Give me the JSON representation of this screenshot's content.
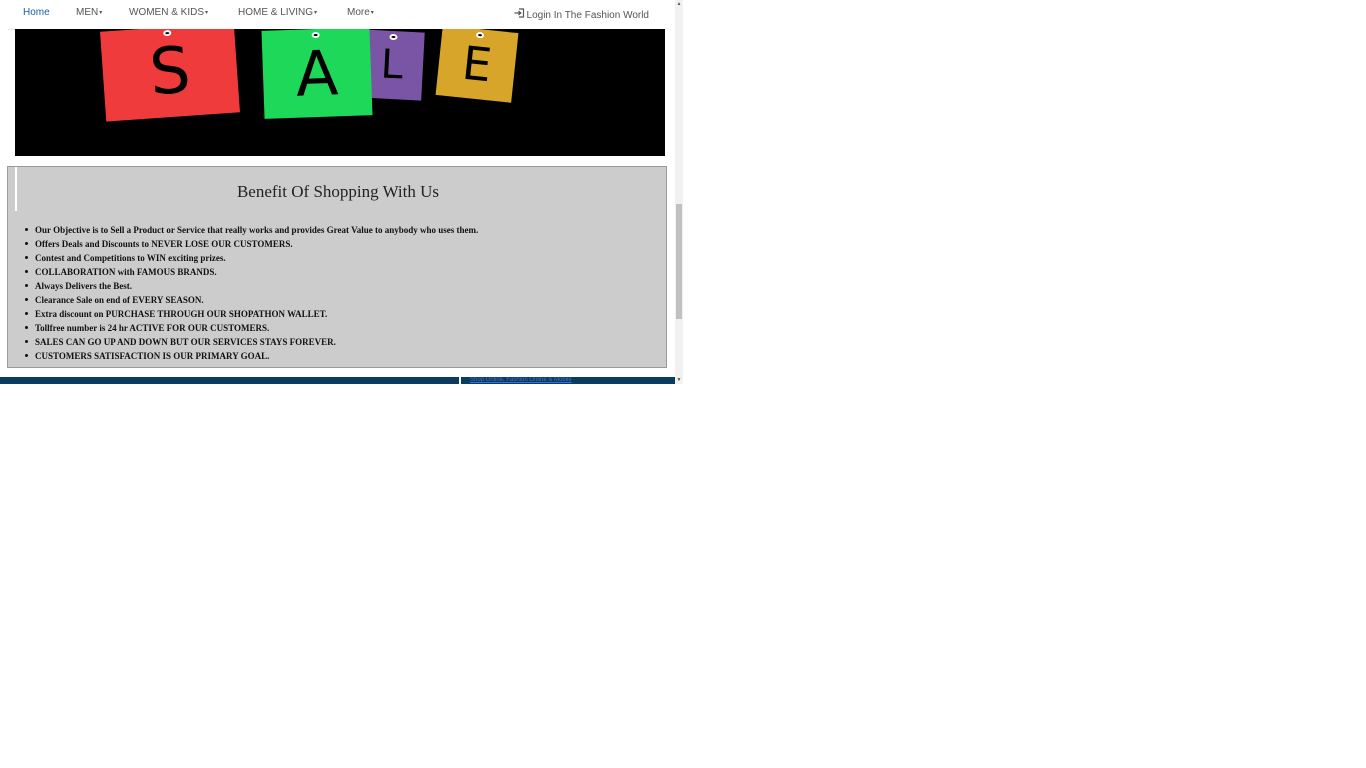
{
  "nav": {
    "home": "Home",
    "men": "MEN",
    "women_kids": "WOMEN & KIDS",
    "home_living": "HOME & LIVING",
    "more": "More",
    "caret": "▾",
    "login": "Login In The Fashion World",
    "login_icon": "sign-in-icon"
  },
  "banner": {
    "letters": [
      "S",
      "A",
      "L",
      "E"
    ],
    "colors": {
      "s": "#ef3b3b",
      "a": "#1ed85a",
      "l": "#7a55a6",
      "e": "#d6a52a"
    }
  },
  "benefits": {
    "title": "Benefit Of Shopping With Us",
    "items": [
      "Our Objective is to Sell a Product or Service that really works and provides Great Value to anybody who uses them.",
      "Offers Deals and Discounts to NEVER LOSE OUR CUSTOMERS.",
      "Contest and Competitions to WIN exciting prizes.",
      "COLLABORATION with FAMOUS BRANDS.",
      "Always Delivers the Best.",
      "Clearance Sale on end of EVERY SEASON.",
      "Extra discount on PURCHASE THROUGH OUR SHOPATHON WALLET.",
      "Tollfree number is 24 hr ACTIVE FOR OUR CUSTOMERS.",
      "SALES CAN GO UP AND DOWN BUT OUR SERVICES STAYS FOREVER.",
      "CUSTOMERS SATISFACTION IS OUR PRIMARY GOAL."
    ]
  },
  "footer": {
    "link": "Shop Online, Fashion Online & Mobile"
  },
  "scrollbar": {
    "up": "▲",
    "down": "▼"
  }
}
